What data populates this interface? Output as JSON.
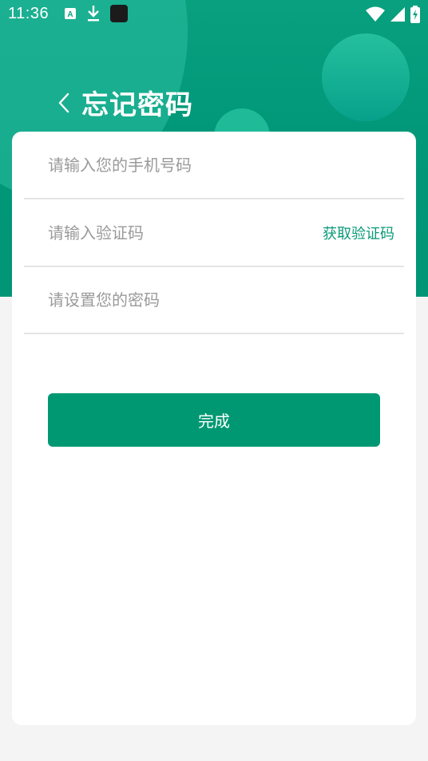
{
  "status_bar": {
    "time": "11:36",
    "left_icons": [
      "font-a-icon",
      "download-icon",
      "app-square-icon"
    ],
    "right_icons": [
      "wifi-icon",
      "cell-signal-icon",
      "battery-charging-icon"
    ]
  },
  "header": {
    "title": "忘记密码",
    "back_icon": "chevron-left-icon"
  },
  "form": {
    "phone": {
      "value": "",
      "placeholder": "请输入您的手机号码"
    },
    "code": {
      "value": "",
      "placeholder": "请输入验证码"
    },
    "get_code_label": "获取验证码",
    "password": {
      "value": "",
      "placeholder": "请设置您的密码"
    },
    "submit_label": "完成"
  },
  "colors": {
    "primary": "#009873",
    "accent_text": "#0b9a78",
    "header_bg": "#009879",
    "page_bg": "#f4f4f4"
  }
}
